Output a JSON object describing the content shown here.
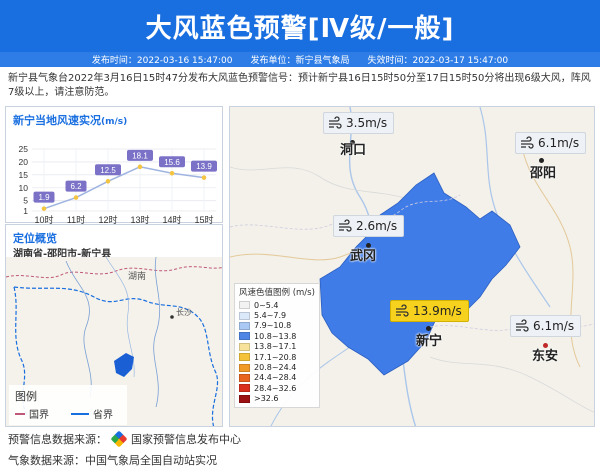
{
  "header": {
    "title": "大风蓝色预警[Ⅳ级/一般]"
  },
  "meta": {
    "publish_time": "发布时间：2022-03-16 15:47:00",
    "publisher": "发布单位：新宁县气象局",
    "expire_time": "失效时间：2022-03-17 15:47:00"
  },
  "description": "新宁县气象台2022年3月16日15时47分发布大风蓝色预警信号：预计新宁县16日15时50分至17日15时50分将出现6级大风，阵风7级以上，请注意防范。",
  "wind_panel": {
    "title": "新宁当地风速实况",
    "unit": "(m/s)"
  },
  "chart_data": {
    "type": "line",
    "categories": [
      "10时",
      "11时",
      "12时",
      "13时",
      "14时",
      "15时"
    ],
    "series": [
      {
        "values": [
          1.9,
          6.2,
          12.5,
          18.1,
          15.6,
          13.9
        ]
      }
    ],
    "value_labels": [
      "1.9",
      "6.2",
      "12.5",
      "18.1",
      "15.6",
      "13.9"
    ],
    "y_ticks": [
      "25",
      "20",
      "15",
      "10",
      "5",
      "1"
    ],
    "ylim": [
      1,
      25
    ],
    "grid": true,
    "colors": {
      "line": "#9fb4e0",
      "point": "#f4c542",
      "label": "#7b72c8"
    }
  },
  "location_panel": {
    "title": "定位概览",
    "path": "湖南省-邵阳市-新宁县",
    "map_labels": [
      "湖南",
      "长沙"
    ],
    "legend": {
      "title": "图例",
      "items": [
        {
          "label": "国界",
          "color": "#c0587a"
        },
        {
          "label": "省界",
          "color": "#1a6fe0"
        }
      ]
    }
  },
  "main_map": {
    "callouts": [
      {
        "id": "dongkou",
        "value": "3.5m/s"
      },
      {
        "id": "shaoyang",
        "value": "6.1m/s"
      },
      {
        "id": "wugang",
        "value": "2.6m/s"
      },
      {
        "id": "xinning",
        "value": "13.9m/s"
      },
      {
        "id": "dongan",
        "value": "6.1m/s"
      }
    ],
    "cities": {
      "dongkou": "洞口",
      "shaoyang": "邵阳",
      "wugang": "武冈",
      "xinning": "新宁",
      "dongan": "东安"
    },
    "scale_legend": {
      "title": "风速色值图例 (m/s)",
      "items": [
        {
          "label": "0~5.4",
          "color": "#f2f2f2"
        },
        {
          "label": "5.4~7.9",
          "color": "#dce9fb"
        },
        {
          "label": "7.9~10.8",
          "color": "#a9c8f3"
        },
        {
          "label": "10.8~13.8",
          "color": "#4f86e6"
        },
        {
          "label": "13.8~17.1",
          "color": "#f6e29a"
        },
        {
          "label": "17.1~20.8",
          "color": "#f5c33b"
        },
        {
          "label": "20.8~24.4",
          "color": "#f19a2a"
        },
        {
          "label": "24.4~28.4",
          "color": "#e8641f"
        },
        {
          "label": "28.4~32.6",
          "color": "#d8301c"
        },
        {
          "label": ">32.6",
          "color": "#9b1010"
        }
      ]
    },
    "region_color": "#3f7ce8"
  },
  "sources": {
    "warning_source": "预警信息数据来源：",
    "warning_org": "国家预警信息发布中心",
    "weather_source": "气象数据来源：中国气象局全国自动站实况"
  }
}
